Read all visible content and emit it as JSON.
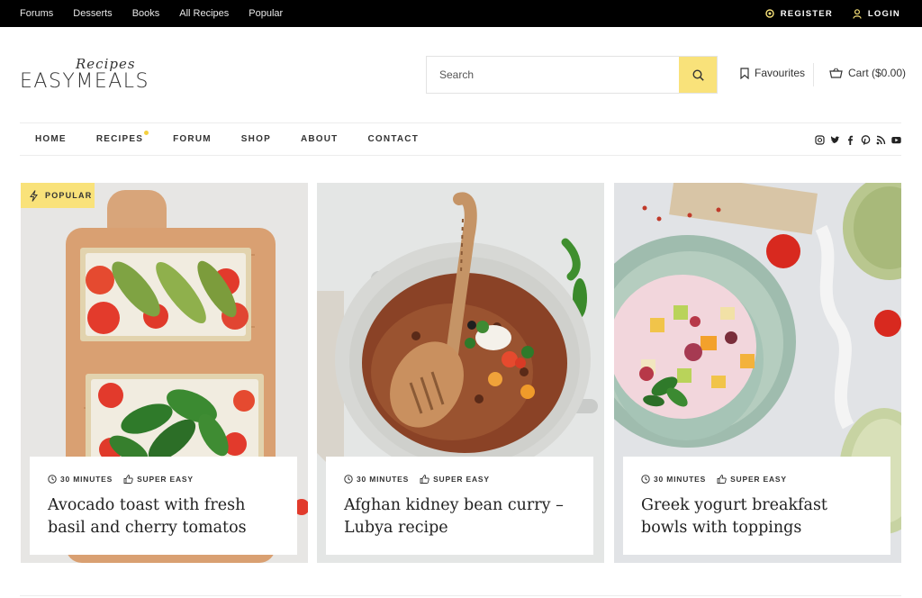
{
  "topbar": {
    "links": [
      "Forums",
      "Desserts",
      "Books",
      "All Recipes",
      "Popular"
    ],
    "register_label": "REGISTER",
    "login_label": "LOGIN"
  },
  "header": {
    "logo_script": "Recipes",
    "logo_word": "EASYMEALS",
    "search": {
      "placeholder": "Search"
    },
    "favourites_label": "Favourites",
    "cart_label": "Cart ($0.00)"
  },
  "nav": {
    "items": [
      "HOME",
      "RECIPES",
      "FORUM",
      "SHOP",
      "ABOUT",
      "CONTACT"
    ],
    "social_icons": [
      "instagram-icon",
      "twitter-icon",
      "facebook-icon",
      "pinterest-icon",
      "rss-icon",
      "youtube-icon"
    ]
  },
  "badge": {
    "label": "POPULAR"
  },
  "cards": [
    {
      "time": "30 MINUTES",
      "difficulty": "SUPER EASY",
      "title": "Avocado toast with fresh basil and cherry tomatos"
    },
    {
      "time": "30 MINUTES",
      "difficulty": "SUPER EASY",
      "title": "Afghan kidney bean curry – Lubya recipe"
    },
    {
      "time": "30 MINUTES",
      "difficulty": "SUPER EASY",
      "title": "Greek yogurt breakfast bowls with toppings"
    }
  ],
  "colors": {
    "accent": "#f9e27a",
    "topbar": "#000000",
    "divider": "#ececec"
  }
}
